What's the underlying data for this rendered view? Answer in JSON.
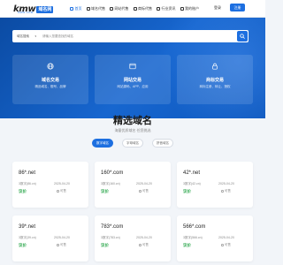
{
  "header": {
    "logo_text": "kmw",
    "logo_badge": "域名网",
    "logo_sub": "KMW.COM",
    "nav": [
      {
        "label": "首页",
        "icon": "home-icon",
        "active": true
      },
      {
        "label": "域名代售",
        "icon": "domain-icon"
      },
      {
        "label": "网站代售",
        "icon": "website-icon"
      },
      {
        "label": "商标代售",
        "icon": "trademark-icon"
      },
      {
        "label": "行业资讯",
        "icon": "news-icon"
      },
      {
        "label": "我的账户",
        "icon": "user-icon"
      }
    ],
    "login_label": "登录",
    "register_label": "注册"
  },
  "hero": {
    "search": {
      "select_value": "域名搜索",
      "placeholder": "请输入您要查找的域名"
    },
    "cards": [
      {
        "title": "域名交易",
        "desc": "精品域名、靓号、品牌",
        "icon": "globe-icon"
      },
      {
        "title": "网站交易",
        "desc": "网站源码、APP、应用",
        "icon": "browser-icon"
      },
      {
        "title": "商标交易",
        "desc": "商标注册、转让、授权",
        "icon": "lock-icon"
      }
    ]
  },
  "section": {
    "title": "精选域名",
    "subtitle": "海量优质域名 任您挑选",
    "tabs": [
      {
        "label": "数字域名",
        "active": true
      },
      {
        "label": "字母域名"
      },
      {
        "label": "拼音域名"
      }
    ]
  },
  "domains": [
    {
      "name": "86*.net",
      "meta": "3数字(86.cn)",
      "date": "2025-04-20",
      "price": "议价",
      "stock": "可售"
    },
    {
      "name": "160*.com",
      "meta": "3数字(160.cn)",
      "date": "2025-04-20",
      "price": "议价",
      "stock": "可售"
    },
    {
      "name": "42*.net",
      "meta": "3数字(42.cn)",
      "date": "2025-04-20",
      "price": "议价",
      "stock": "可售"
    },
    {
      "name": "39*.net",
      "meta": "3数字(39.cn)",
      "date": "2025-04-20",
      "price": "议价",
      "stock": "可售"
    },
    {
      "name": "783*.com",
      "meta": "3数字(783.cn)",
      "date": "2025-04-20",
      "price": "议价",
      "stock": "可售"
    },
    {
      "name": "566*.com",
      "meta": "3数字(566.cn)",
      "date": "2025-04-20",
      "price": "议价",
      "stock": "可售"
    }
  ]
}
